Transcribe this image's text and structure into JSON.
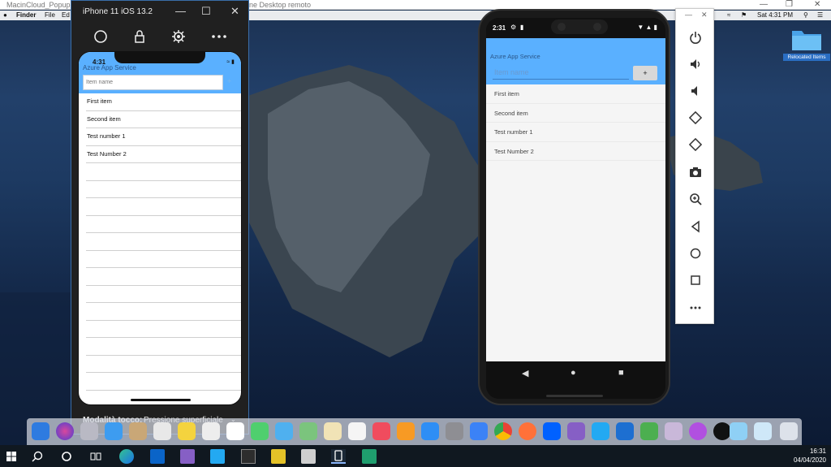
{
  "host": {
    "window_title_left": "MacinCloud_Popup",
    "window_title_right": "ne Desktop remoto"
  },
  "mac": {
    "menubar": {
      "finder": "Finder",
      "file": "File",
      "edit": "Ed",
      "clock": "Sat 4:31 PM"
    },
    "desktop_icon_label": "Relocated Items"
  },
  "ios_simulator": {
    "title": "iPhone 11 iOS 13.2",
    "status_time": "4:31",
    "app_title": "Azure App Service",
    "input_placeholder": "Item name",
    "add_label": "+",
    "items": [
      "First item",
      "Second item",
      "Test number 1",
      "Test Number 2"
    ],
    "touch_mode_label": "Modalità tocco:",
    "touch_mode_value": "Pressione superficiale"
  },
  "android": {
    "status_time": "2:31",
    "app_title": "Azure App Service",
    "input_placeholder": "Item name",
    "add_label": "+",
    "items": [
      "First item",
      "Second item",
      "Test number 1",
      "Test Number 2"
    ]
  },
  "taskbar": {
    "time": "16:31",
    "date": "04/04/2020"
  },
  "colors": {
    "app_header": "#5ab0ff",
    "window_border": "#3a6ea8"
  }
}
